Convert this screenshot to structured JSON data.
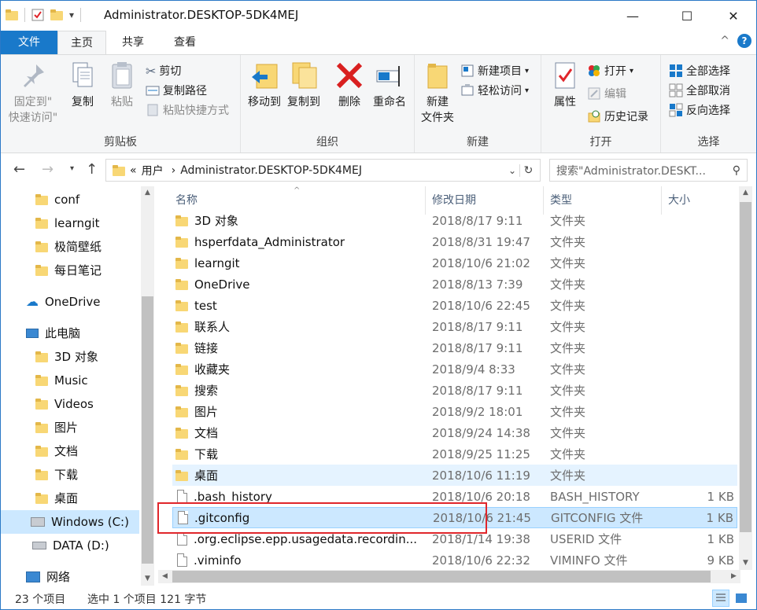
{
  "window": {
    "title": "Administrator.DESKTOP-5DK4MEJ",
    "qat_dropdown": "▾",
    "controls": {
      "minimize": "—",
      "maximize": "☐",
      "close": "✕"
    }
  },
  "ribbon_tabs": {
    "file": "文件",
    "home": "主页",
    "share": "共享",
    "view": "查看",
    "collapse": "^",
    "help": "?"
  },
  "ribbon": {
    "clipboard": {
      "label": "剪贴板",
      "pin": "固定到\"\n快速访问\"",
      "pin_l1": "固定到\"",
      "pin_l2": "快速访问\"",
      "copy": "复制",
      "paste": "粘贴",
      "cut": "剪切",
      "copy_path": "复制路径",
      "paste_shortcut": "粘贴快捷方式"
    },
    "organize": {
      "label": "组织",
      "move_to": "移动到",
      "copy_to": "复制到",
      "delete": "删除",
      "rename": "重命名"
    },
    "new": {
      "label": "新建",
      "new_folder_l1": "新建",
      "new_folder_l2": "文件夹",
      "new_item": "新建项目",
      "easy_access": "轻松访问"
    },
    "open": {
      "label": "打开",
      "properties": "属性",
      "open": "打开",
      "edit": "编辑",
      "history": "历史记录"
    },
    "select": {
      "label": "选择",
      "select_all": "全部选择",
      "select_none": "全部取消",
      "invert": "反向选择"
    }
  },
  "address": {
    "prefix": "«",
    "crumb1": "用户",
    "crumb2": "Administrator.DESKTOP-5DK4MEJ",
    "search_placeholder": "搜索\"Administrator.DESKT..."
  },
  "nav_pane": {
    "items": [
      {
        "label": "conf"
      },
      {
        "label": "learngit"
      },
      {
        "label": "极简壁纸"
      },
      {
        "label": "每日笔记"
      },
      {
        "label": "OneDrive"
      },
      {
        "label": "此电脑"
      },
      {
        "label": "3D 对象"
      },
      {
        "label": "Music"
      },
      {
        "label": "Videos"
      },
      {
        "label": "图片"
      },
      {
        "label": "文档"
      },
      {
        "label": "下载"
      },
      {
        "label": "桌面"
      },
      {
        "label": "Windows (C:)"
      },
      {
        "label": "DATA (D:)"
      },
      {
        "label": "网络"
      }
    ]
  },
  "columns": {
    "name": "名称",
    "date": "修改日期",
    "type": "类型",
    "size": "大小"
  },
  "files": [
    {
      "name": "3D 对象",
      "date": "2018/8/17 9:11",
      "type": "文件夹",
      "size": ""
    },
    {
      "name": "hsperfdata_Administrator",
      "date": "2018/8/31 19:47",
      "type": "文件夹",
      "size": ""
    },
    {
      "name": "learngit",
      "date": "2018/10/6 21:02",
      "type": "文件夹",
      "size": ""
    },
    {
      "name": "OneDrive",
      "date": "2018/8/13 7:39",
      "type": "文件夹",
      "size": ""
    },
    {
      "name": "test",
      "date": "2018/10/6 22:45",
      "type": "文件夹",
      "size": ""
    },
    {
      "name": "联系人",
      "date": "2018/8/17 9:11",
      "type": "文件夹",
      "size": ""
    },
    {
      "name": "链接",
      "date": "2018/8/17 9:11",
      "type": "文件夹",
      "size": ""
    },
    {
      "name": "收藏夹",
      "date": "2018/9/4 8:33",
      "type": "文件夹",
      "size": ""
    },
    {
      "name": "搜索",
      "date": "2018/8/17 9:11",
      "type": "文件夹",
      "size": ""
    },
    {
      "name": "图片",
      "date": "2018/9/2 18:01",
      "type": "文件夹",
      "size": ""
    },
    {
      "name": "文档",
      "date": "2018/9/24 14:38",
      "type": "文件夹",
      "size": ""
    },
    {
      "name": "下载",
      "date": "2018/9/25 11:25",
      "type": "文件夹",
      "size": ""
    },
    {
      "name": "桌面",
      "date": "2018/10/6 11:19",
      "type": "文件夹",
      "size": ""
    },
    {
      "name": ".bash_history",
      "date": "2018/10/6 20:18",
      "type": "BASH_HISTORY",
      "size": "1 KB"
    },
    {
      "name": ".gitconfig",
      "date": "2018/10/6 21:45",
      "type": "GITCONFIG 文件",
      "size": "1 KB"
    },
    {
      "name": ".org.eclipse.epp.usagedata.recordin...",
      "date": "2018/1/14 19:38",
      "type": "USERID 文件",
      "size": "1 KB"
    },
    {
      "name": ".viminfo",
      "date": "2018/10/6 22:32",
      "type": "VIMINFO 文件",
      "size": "9 KB"
    }
  ],
  "status": {
    "count": "23 个项目",
    "selection": "选中 1 个项目  121 字节"
  },
  "colors": {
    "accent": "#1979ca",
    "selection": "#cce8ff",
    "hover": "#e5f3ff",
    "folder": "#f8d775",
    "highlight_box": "#e0262b"
  }
}
